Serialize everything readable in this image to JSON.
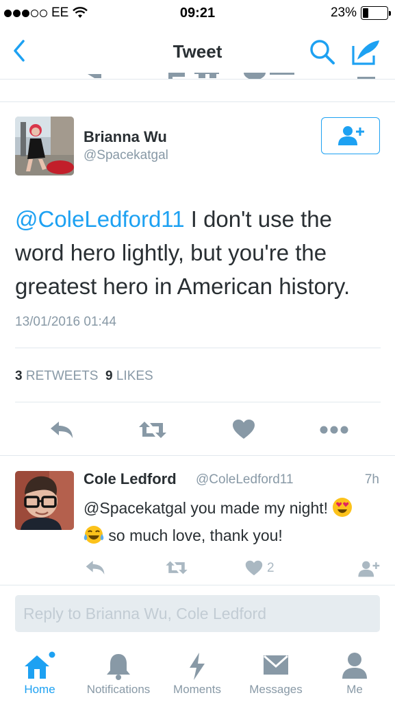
{
  "status_bar": {
    "carrier": "EE",
    "time": "09:21",
    "battery": "23%",
    "battery_fraction": 0.23
  },
  "nav": {
    "title": "Tweet"
  },
  "tweet": {
    "author_name": "Brianna Wu",
    "author_handle": "@Spacekatgal",
    "mention": "@ColeLedford11",
    "text": " I don't use the word hero lightly, but you're the greatest hero in American history.",
    "timestamp": "13/01/2016 01:44",
    "retweets_count": "3",
    "retweets_label": "RETWEETS",
    "likes_count": "9",
    "likes_label": "LIKES"
  },
  "reply": {
    "author_name": "Cole Ledford",
    "author_handle": "@ColeLedford11",
    "time": "7h",
    "text_part1": "@Spacekatgal you made my night! ",
    "text_part2": " so much love, thank you!",
    "emoji1": "heart-eyes-emoji",
    "emoji2": "tears-of-joy-emoji",
    "like_count": "2"
  },
  "reply_box": {
    "placeholder": "Reply to Brianna Wu, Cole Ledford"
  },
  "tabs": [
    {
      "label": "Home",
      "icon": "home-icon",
      "active": true
    },
    {
      "label": "Notifications",
      "icon": "bell-icon"
    },
    {
      "label": "Moments",
      "icon": "lightning-icon"
    },
    {
      "label": "Messages",
      "icon": "envelope-icon"
    },
    {
      "label": "Me",
      "icon": "person-icon"
    }
  ],
  "colors": {
    "accent": "#1da1f2",
    "icon_gray": "#8899a6",
    "light_gray": "#aab8c2",
    "text": "#292f33"
  }
}
